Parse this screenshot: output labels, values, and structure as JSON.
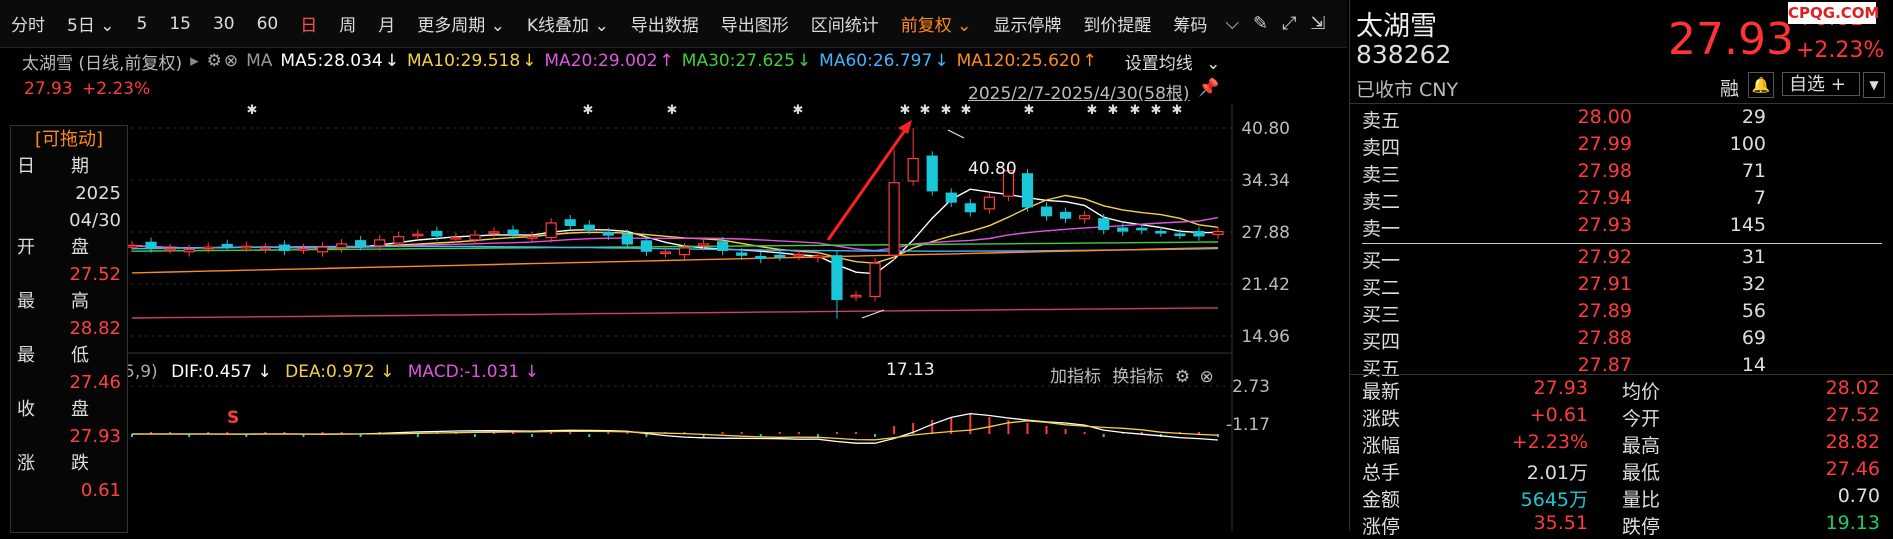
{
  "toolbar": {
    "items": [
      "分时",
      "5日",
      "5",
      "15",
      "30",
      "60",
      "日",
      "周",
      "月",
      "更多周期",
      "K线叠加",
      "导出数据",
      "导出图形",
      "区间统计",
      "前复权",
      "显示停牌",
      "到价提醒",
      "筹码"
    ],
    "active": "日"
  },
  "ma_line": {
    "name": "太湖雪 (日线,前复权)",
    "ma_label": "MA",
    "ma5": "MA5:28.034",
    "ma10": "MA10:29.518",
    "ma20": "MA20:29.002",
    "ma30": "MA30:27.625",
    "ma60": "MA60:26.797",
    "ma120": "MA120:25.620",
    "ma_settings": "设置均线"
  },
  "sub_line": {
    "price": "27.93",
    "change": "+2.23%",
    "range": "2025/2/7-2025/4/30(58根)"
  },
  "info_panel": {
    "title": "[可拖动]",
    "date_label1": "日",
    "date_label2": "期",
    "year": "2025",
    "monthday": "04/30",
    "open_l1": "开",
    "open_l2": "盘",
    "open_v": "27.52",
    "high_l1": "最",
    "high_l2": "高",
    "high_v": "28.82",
    "low_l1": "最",
    "low_l2": "低",
    "low_v": "27.46",
    "close_l1": "收",
    "close_l2": "盘",
    "close_v": "27.93",
    "chg_l1": "涨",
    "chg_l2": "跌",
    "chg_v": "0.61"
  },
  "chart": {
    "price_ticks": [
      "40.80",
      "34.34",
      "27.88",
      "21.42",
      "14.96"
    ],
    "annot_high": "40.80",
    "annot_low": "17.13",
    "macd_ticks": [
      "2.73",
      "-1.17"
    ],
    "macd_params": "5,9)",
    "dif": "DIF:0.457",
    "dea": "DEA:0.972",
    "macd": "MACD:-1.031",
    "add_indicator": "加指标",
    "switch_indicator": "换指标",
    "s_marker": "S",
    "colors": {
      "up": "#ff3b3b",
      "down": "#19c7d8",
      "ma5": "#ffffff",
      "ma10": "#f5d142",
      "ma20": "#e055e0",
      "ma30": "#3ed13e",
      "ma60": "#42b4ff",
      "ma120": "#ff8c1a",
      "ma_long": "#d43f5a"
    }
  },
  "chart_data": {
    "type": "candlestick",
    "title": "太湖雪 (日线,前复权)",
    "x_range": "2025/2/7-2025/4/30",
    "bars": 58,
    "ylim": [
      14.96,
      40.8
    ],
    "high": 40.8,
    "low": 17.13,
    "last_close": 27.93
  },
  "quote": {
    "name": "太湖雪",
    "code": "838262",
    "status": "已收市 CNY",
    "price": "27.93",
    "change": "+0.61",
    "change_pct": "+2.23%",
    "brand": "CPQG.COM",
    "rong": "融",
    "watch": "自选 +"
  },
  "orderbook": {
    "asks": [
      {
        "label": "卖五",
        "price": "28.00",
        "vol": "29"
      },
      {
        "label": "卖四",
        "price": "27.99",
        "vol": "100"
      },
      {
        "label": "卖三",
        "price": "27.98",
        "vol": "71"
      },
      {
        "label": "卖二",
        "price": "27.94",
        "vol": "7"
      },
      {
        "label": "卖一",
        "price": "27.93",
        "vol": "145"
      }
    ],
    "bids": [
      {
        "label": "买一",
        "price": "27.92",
        "vol": "31"
      },
      {
        "label": "买二",
        "price": "27.91",
        "vol": "32"
      },
      {
        "label": "买三",
        "price": "27.89",
        "vol": "56"
      },
      {
        "label": "买四",
        "price": "27.88",
        "vol": "69"
      },
      {
        "label": "买五",
        "price": "27.87",
        "vol": "14"
      }
    ]
  },
  "stats": [
    {
      "l1": "最新",
      "v1": "27.93",
      "l2": "均价",
      "v2": "28.02"
    },
    {
      "l1": "涨跌",
      "v1": "+0.61",
      "l2": "今开",
      "v2": "27.52"
    },
    {
      "l1": "涨幅",
      "v1": "+2.23%",
      "l2": "最高",
      "v2": "28.82"
    },
    {
      "l1": "总手",
      "v1": "2.01万",
      "l2": "最低",
      "v2": "27.46"
    },
    {
      "l1": "金额",
      "v1": "5645万",
      "l2": "量比",
      "v2": "0.70"
    },
    {
      "l1": "涨停",
      "v1": "35.51",
      "l2": "跌停",
      "v2": "19.13"
    }
  ]
}
